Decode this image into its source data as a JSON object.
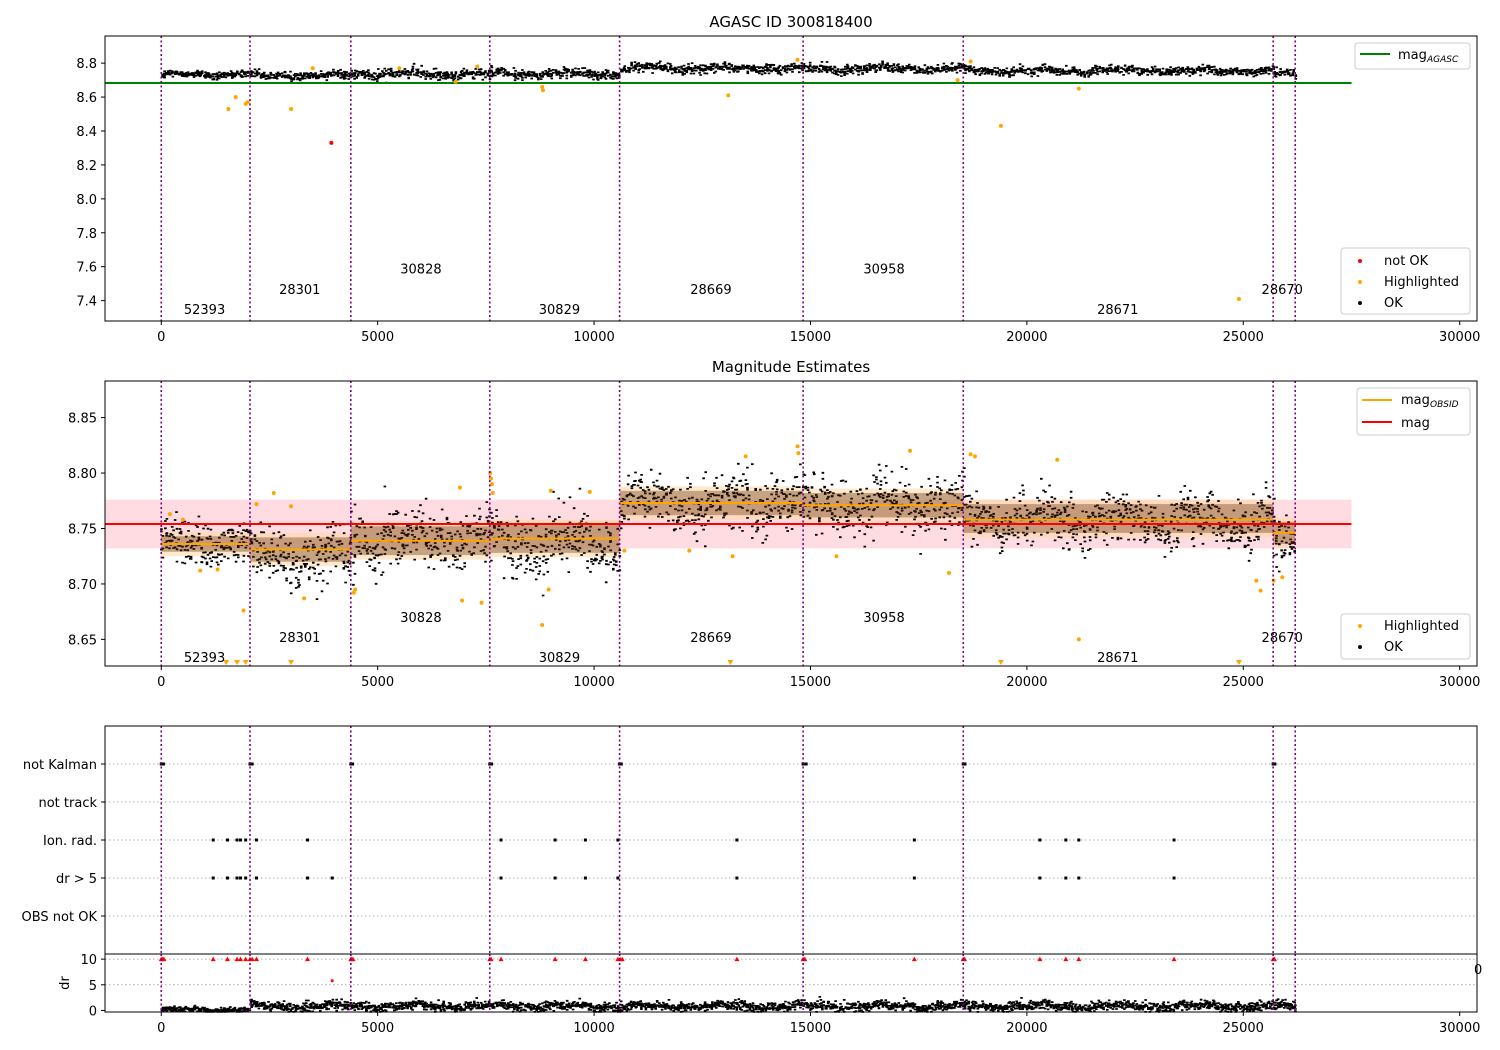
{
  "figure": {
    "title_top": "AGASC ID 300818400",
    "title_mid": "Magnitude Estimates"
  },
  "colors": {
    "ok": "#000000",
    "highlighted": "#ffa500",
    "not_ok": "#ff0000",
    "mag_agasc": "#008000",
    "mag": "#ff0000",
    "mag_obsid": "#ffa500",
    "obs_boundary": "#800080",
    "band_mag": "#ffc0cb",
    "band_obsid": "#ffd8a8"
  },
  "chart_data": [
    {
      "type": "scatter",
      "title": "AGASC ID 300818400",
      "xlim": [
        -1300,
        30400
      ],
      "ylim": [
        7.28,
        8.96
      ],
      "xticks": [
        0,
        5000,
        10000,
        15000,
        20000,
        25000,
        30000
      ],
      "xtick_labels": [
        "0",
        "5000",
        "10000",
        "15000",
        "20000",
        "25000",
        "30000"
      ],
      "yticks": [
        7.4,
        7.6,
        7.8,
        8.0,
        8.2,
        8.4,
        8.6,
        8.8
      ],
      "ytick_labels": [
        "7.4",
        "7.6",
        "7.8",
        "8.0",
        "8.2",
        "8.4",
        "8.6",
        "8.8"
      ],
      "legend_upper": [
        "mag_AGASC"
      ],
      "legend_upper_placement": "top-right",
      "legend_lower": [
        "not OK",
        "Highlighted",
        "OK"
      ],
      "legend_lower_placement": "bottom-right",
      "mag_agasc": 8.683,
      "mag_agasc_x": [
        -1300,
        27500
      ],
      "series_ok_segments": [
        {
          "x": [
            0,
            2050
          ],
          "mean": 8.737,
          "spread": 0.01
        },
        {
          "x": [
            2050,
            4380
          ],
          "mean": 8.733,
          "spread": 0.012
        },
        {
          "x": [
            4380,
            7600
          ],
          "mean": 8.742,
          "spread": 0.014
        },
        {
          "x": [
            7600,
            10600
          ],
          "mean": 8.742,
          "spread": 0.014
        },
        {
          "x": [
            10600,
            14850
          ],
          "mean": 8.774,
          "spread": 0.013
        },
        {
          "x": [
            14850,
            18550
          ],
          "mean": 8.772,
          "spread": 0.013
        },
        {
          "x": [
            18550,
            25700
          ],
          "mean": 8.76,
          "spread": 0.012
        },
        {
          "x": [
            25700,
            26200
          ],
          "mean": 8.743,
          "spread": 0.01
        }
      ],
      "highlighted_points": [
        [
          1550,
          8.53
        ],
        [
          1720,
          8.6
        ],
        [
          1950,
          8.56
        ],
        [
          2000,
          8.57
        ],
        [
          3000,
          8.53
        ],
        [
          6800,
          8.69
        ],
        [
          8800,
          8.66
        ],
        [
          8820,
          8.64
        ],
        [
          13100,
          8.61
        ],
        [
          18400,
          8.7
        ],
        [
          19400,
          8.43
        ],
        [
          21200,
          8.65
        ],
        [
          24900,
          7.41
        ],
        [
          3500,
          8.77
        ],
        [
          5500,
          8.77
        ],
        [
          7300,
          8.78
        ],
        [
          14700,
          8.82
        ],
        [
          18700,
          8.81
        ]
      ],
      "not_ok_points": [
        [
          3930,
          8.33
        ]
      ],
      "obs_boundaries": [
        0,
        2050,
        4380,
        7590,
        10590,
        14830,
        18530,
        25690,
        26200
      ],
      "obsids": [
        {
          "label": "52393",
          "x": 1000,
          "y": 7.35
        },
        {
          "label": "28301",
          "x": 3200,
          "y": 7.47
        },
        {
          "label": "30828",
          "x": 6000,
          "y": 7.59
        },
        {
          "label": "30829",
          "x": 9200,
          "y": 7.35
        },
        {
          "label": "28669",
          "x": 12700,
          "y": 7.47
        },
        {
          "label": "30958",
          "x": 16700,
          "y": 7.59
        },
        {
          "label": "28671",
          "x": 22100,
          "y": 7.35
        },
        {
          "label": "28670",
          "x": 25900,
          "y": 7.47
        }
      ]
    },
    {
      "type": "scatter",
      "title": "Magnitude Estimates",
      "xlim": [
        -1300,
        30400
      ],
      "ylim": [
        8.626,
        8.883
      ],
      "xticks": [
        0,
        5000,
        10000,
        15000,
        20000,
        25000,
        30000
      ],
      "xtick_labels": [
        "0",
        "5000",
        "10000",
        "15000",
        "20000",
        "25000",
        "30000"
      ],
      "yticks": [
        8.65,
        8.7,
        8.75,
        8.8,
        8.85
      ],
      "ytick_labels": [
        "8.65",
        "8.70",
        "8.75",
        "8.80",
        "8.85"
      ],
      "legend_upper": [
        "mag_OBSID",
        "mag"
      ],
      "legend_upper_placement": "top-right",
      "legend_lower": [
        "Highlighted",
        "OK"
      ],
      "legend_lower_placement": "bottom-right",
      "mag": 8.754,
      "mag_band": [
        8.732,
        8.776
      ],
      "mag_x": [
        -1300,
        27500
      ],
      "obsid_mags": [
        {
          "x": [
            0,
            2050
          ],
          "mag": 8.736,
          "band": [
            8.725,
            8.747
          ]
        },
        {
          "x": [
            2050,
            4380
          ],
          "mag": 8.731,
          "band": [
            8.716,
            8.746
          ]
        },
        {
          "x": [
            4380,
            7590
          ],
          "mag": 8.739,
          "band": [
            8.722,
            8.756
          ]
        },
        {
          "x": [
            7590,
            10590
          ],
          "mag": 8.741,
          "band": [
            8.724,
            8.758
          ]
        },
        {
          "x": [
            10590,
            14830
          ],
          "mag": 8.773,
          "band": [
            8.758,
            8.788
          ]
        },
        {
          "x": [
            14830,
            18530
          ],
          "mag": 8.771,
          "band": [
            8.756,
            8.786
          ]
        },
        {
          "x": [
            18530,
            25690
          ],
          "mag": 8.758,
          "band": [
            8.742,
            8.776
          ]
        },
        {
          "x": [
            25690,
            26200
          ],
          "mag": 8.746,
          "band": [
            8.732,
            8.76
          ]
        }
      ],
      "series_ok_segments": [
        {
          "x": [
            0,
            2050
          ],
          "mean": 8.737,
          "spread": 0.009
        },
        {
          "x": [
            2050,
            4380
          ],
          "mean": 8.725,
          "spread": 0.012
        },
        {
          "x": [
            4380,
            7600
          ],
          "mean": 8.742,
          "spread": 0.013
        },
        {
          "x": [
            7600,
            10600
          ],
          "mean": 8.738,
          "spread": 0.014
        },
        {
          "x": [
            10600,
            14850
          ],
          "mean": 8.774,
          "spread": 0.012
        },
        {
          "x": [
            14850,
            18550
          ],
          "mean": 8.772,
          "spread": 0.012
        },
        {
          "x": [
            18550,
            25700
          ],
          "mean": 8.758,
          "spread": 0.011
        },
        {
          "x": [
            25700,
            26200
          ],
          "mean": 8.735,
          "spread": 0.012
        }
      ],
      "highlighted_points": [
        [
          200,
          8.763
        ],
        [
          500,
          8.758
        ],
        [
          900,
          8.712
        ],
        [
          1300,
          8.713
        ],
        [
          1900,
          8.676
        ],
        [
          2200,
          8.772
        ],
        [
          2600,
          8.782
        ],
        [
          3000,
          8.77
        ],
        [
          3300,
          8.687
        ],
        [
          4450,
          8.692
        ],
        [
          4480,
          8.695
        ],
        [
          6900,
          8.787
        ],
        [
          6950,
          8.685
        ],
        [
          7400,
          8.683
        ],
        [
          7600,
          8.8
        ],
        [
          7620,
          8.795
        ],
        [
          7640,
          8.79
        ],
        [
          7660,
          8.782
        ],
        [
          8800,
          8.663
        ],
        [
          8950,
          8.695
        ],
        [
          9000,
          8.784
        ],
        [
          9900,
          8.783
        ],
        [
          10700,
          8.73
        ],
        [
          12200,
          8.73
        ],
        [
          13200,
          8.725
        ],
        [
          13500,
          8.815
        ],
        [
          14700,
          8.824
        ],
        [
          14720,
          8.818
        ],
        [
          15600,
          8.725
        ],
        [
          17300,
          8.82
        ],
        [
          18200,
          8.71
        ],
        [
          18700,
          8.817
        ],
        [
          18800,
          8.815
        ],
        [
          20700,
          8.812
        ],
        [
          21200,
          8.65
        ],
        [
          25300,
          8.703
        ],
        [
          25400,
          8.694
        ],
        [
          25700,
          8.703
        ],
        [
          25900,
          8.706
        ]
      ],
      "highlighted_below": [
        1500,
        1750,
        1950,
        3000,
        13150,
        19400,
        24900
      ],
      "obs_boundaries": [
        0,
        2050,
        4380,
        7590,
        10590,
        14830,
        18530,
        25690,
        26200
      ],
      "obsids": [
        {
          "label": "52393",
          "x": 1000,
          "y": 8.634
        },
        {
          "label": "28301",
          "x": 3200,
          "y": 8.652
        },
        {
          "label": "30828",
          "x": 6000,
          "y": 8.67
        },
        {
          "label": "30829",
          "x": 9200,
          "y": 8.634
        },
        {
          "label": "28669",
          "x": 12700,
          "y": 8.652
        },
        {
          "label": "30958",
          "x": 16700,
          "y": 8.67
        },
        {
          "label": "28671",
          "x": 22100,
          "y": 8.634
        },
        {
          "label": "28670",
          "x": 25900,
          "y": 8.652
        }
      ]
    },
    {
      "type": "scatter",
      "title": "",
      "xlim": [
        -1300,
        30400
      ],
      "flag_labels": [
        "not Kalman",
        "not track",
        "Ion. rad.",
        "dr > 5",
        "OBS not OK"
      ],
      "flags": {
        "not Kalman": [
          0,
          50,
          2050,
          2100,
          4380,
          4420,
          7590,
          7630,
          10590,
          10630,
          14830,
          14900,
          18530,
          18570,
          25690,
          25730
        ],
        "not track": [],
        "Ion. rad.": [
          1200,
          1530,
          1750,
          1830,
          1950,
          2200,
          3380,
          7850,
          9100,
          9800,
          10550,
          13300,
          17400,
          20300,
          20900,
          21200,
          23400
        ],
        "dr > 5": [
          1200,
          1530,
          1750,
          1830,
          1950,
          2200,
          3380,
          3950,
          7850,
          9100,
          9800,
          10550,
          13300,
          17400,
          20300,
          20900,
          21200,
          23400
        ],
        "OBS not OK": []
      },
      "obs_boundaries": [
        0,
        2050,
        4380,
        7590,
        10590,
        14830,
        18530,
        25690,
        26200
      ]
    },
    {
      "type": "scatter",
      "title": "",
      "ylabel": "dr",
      "xlim": [
        -1300,
        30400
      ],
      "ylim": [
        -0.3,
        11
      ],
      "xticks": [
        0,
        5000,
        10000,
        15000,
        20000,
        25000,
        30000
      ],
      "xtick_labels": [
        "0",
        "5000",
        "10000",
        "15000",
        "20000",
        "25000",
        "30000"
      ],
      "yticks": [
        0,
        5,
        10
      ],
      "ytick_labels": [
        "0",
        "5",
        "10"
      ],
      "edge_tick_label": "0",
      "series_ok_segments": [
        {
          "x": [
            0,
            2050
          ],
          "mean": 0.3,
          "spread": 0.25
        },
        {
          "x": [
            2050,
            26200
          ],
          "mean": 1.0,
          "spread": 0.45
        }
      ],
      "capped_points_at_10": [
        0,
        30,
        60,
        1200,
        1530,
        1750,
        1830,
        1950,
        2050,
        2100,
        2200,
        3380,
        4380,
        4400,
        4430,
        7590,
        7620,
        7850,
        9100,
        9800,
        10550,
        10600,
        10650,
        13300,
        14830,
        14870,
        17400,
        18530,
        18560,
        20300,
        20900,
        21200,
        23400,
        25690,
        25720
      ],
      "red_points": [
        [
          3950,
          5.8
        ]
      ],
      "obs_boundaries": [
        0,
        2050,
        4380,
        7590,
        10590,
        14830,
        18530,
        25690,
        26200
      ]
    }
  ]
}
